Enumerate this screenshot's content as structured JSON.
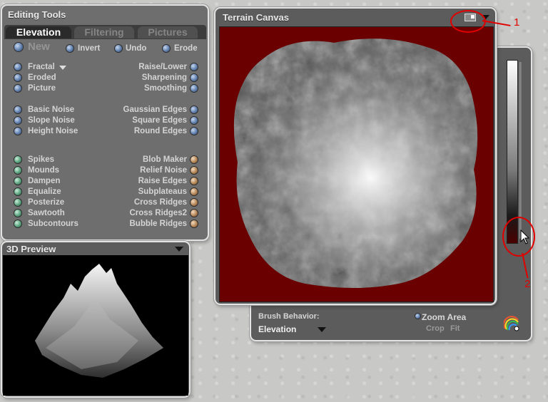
{
  "editing_tools": {
    "title": "Editing Tools",
    "tabs": [
      {
        "label": "Elevation",
        "active": true
      },
      {
        "label": "Filtering",
        "active": false
      },
      {
        "label": "Pictures",
        "active": false
      }
    ],
    "top_row": {
      "new": "New",
      "invert": "Invert",
      "undo": "Undo",
      "erode": "Erode"
    },
    "group1_left": [
      "Fractal",
      "Eroded",
      "Picture"
    ],
    "group1_right": [
      "Raise/Lower",
      "Sharpening",
      "Smoothing"
    ],
    "group2_left": [
      "Basic Noise",
      "Slope Noise",
      "Height Noise"
    ],
    "group2_right": [
      "Gaussian Edges",
      "Square Edges",
      "Round Edges"
    ],
    "group3_left": [
      "Spikes",
      "Mounds",
      "Dampen",
      "Equalize",
      "Posterize",
      "Sawtooth",
      "Subcontours"
    ],
    "group3_right": [
      "Blob Maker",
      "Relief Noise",
      "Raise Edges",
      "Subplateaus",
      "Cross Ridges",
      "Cross Ridges2",
      "Bubble Ridges"
    ]
  },
  "terrain_canvas": {
    "title": "Terrain Canvas",
    "brush_behavior_label": "Brush Behavior:",
    "brush_behavior_value": "Elevation",
    "zoom_area": "Zoom Area",
    "crop": "Crop",
    "fit": "Fit",
    "bg_color": "#6a0000"
  },
  "preview": {
    "title": "3D Preview"
  },
  "annotations": {
    "one": "1",
    "two": "2"
  }
}
